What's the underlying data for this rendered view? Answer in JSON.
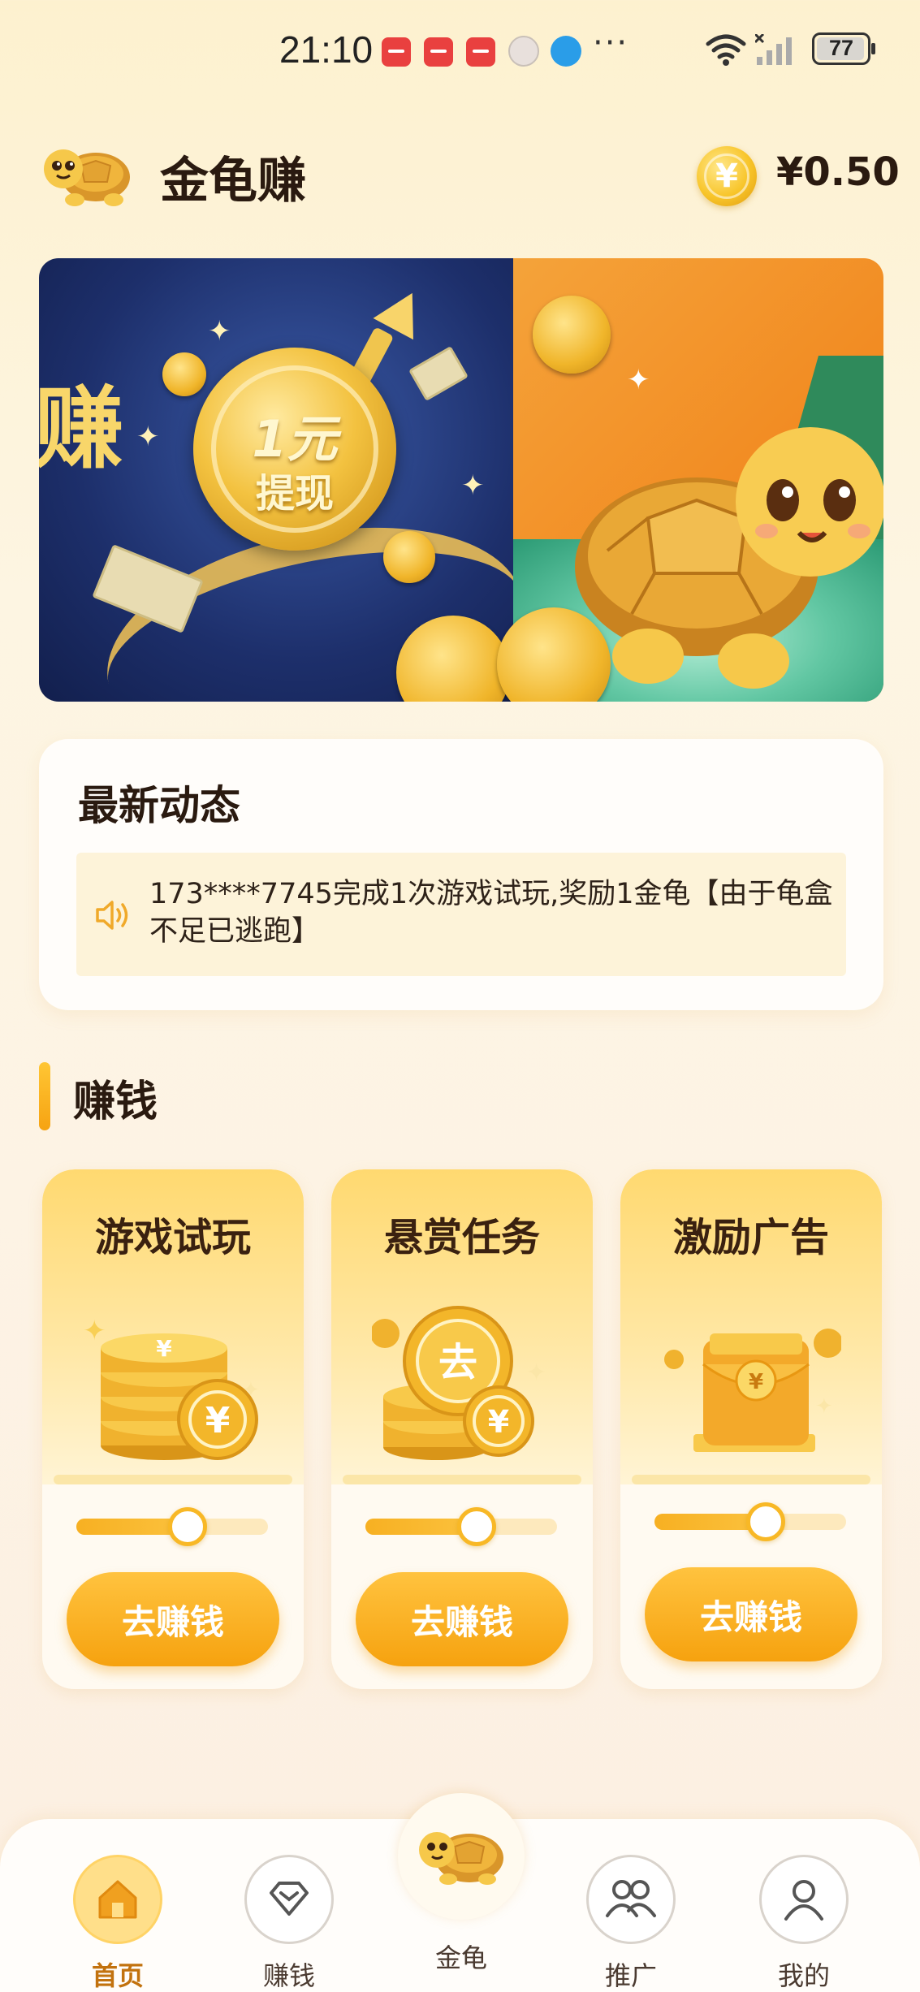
{
  "status_bar": {
    "time": "21:10",
    "battery": "77",
    "icons": [
      "huawei-app-icon",
      "huawei-app-icon",
      "huawei-app-icon",
      "avatar-icon",
      "globe-icon",
      "more-icon",
      "wifi-icon",
      "signal-icon",
      "battery-icon"
    ],
    "more": "···"
  },
  "header": {
    "title": "金龟赚",
    "balance": "¥0.50",
    "coin_symbol": "¥"
  },
  "banner": {
    "side_char": "赚",
    "coin_line1": "1元",
    "coin_line2": "提现"
  },
  "news": {
    "title": "最新动态",
    "message": "173****7745完成1次游戏试玩,奖励1金龟【由于龟盒不足已逃跑】"
  },
  "earn": {
    "section_title": "赚钱",
    "cards": [
      {
        "title": "游戏试玩",
        "button": "去赚钱",
        "progress": 0.58,
        "art": "coin-stack-icon"
      },
      {
        "title": "悬赏任务",
        "button": "去赚钱",
        "progress": 0.58,
        "art": "coin-go-icon",
        "art_text": "去"
      },
      {
        "title": "激励广告",
        "button": "去赚钱",
        "progress": 0.58,
        "art": "red-envelope-icon"
      }
    ]
  },
  "nav": {
    "items": [
      {
        "label": "首页",
        "icon": "home-icon",
        "active": true
      },
      {
        "label": "赚钱",
        "icon": "diamond-icon",
        "active": false
      },
      {
        "label": "金龟",
        "icon": "turtle-icon",
        "active": false
      },
      {
        "label": "推广",
        "icon": "people-icon",
        "active": false
      },
      {
        "label": "我的",
        "icon": "user-icon",
        "active": false
      }
    ]
  },
  "colors": {
    "accent": "#f6a20f",
    "accent_light": "#ffd970",
    "background": "#fdf3e4",
    "active_nav": "#c2720e"
  }
}
